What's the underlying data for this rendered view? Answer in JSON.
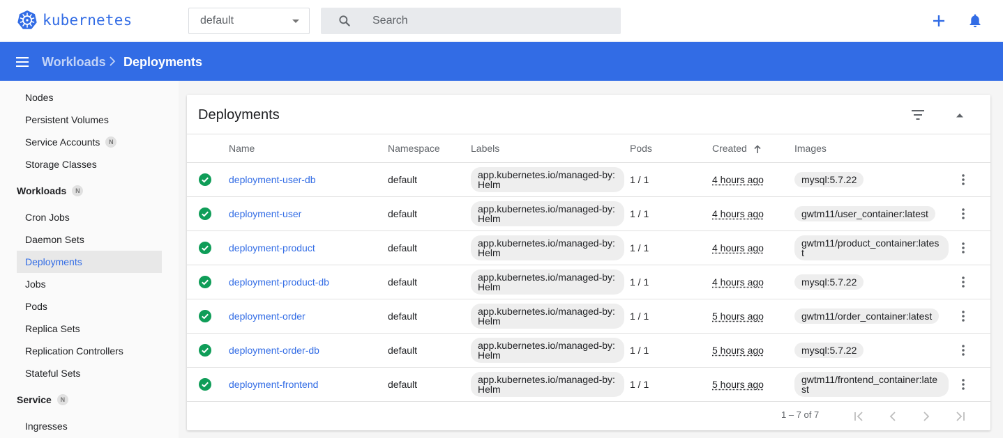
{
  "app": {
    "name": "kubernetes",
    "brand_color": "#326ce5"
  },
  "namespace_select": {
    "value": "default"
  },
  "search": {
    "placeholder": "Search"
  },
  "breadcrumb": {
    "root": "Workloads",
    "current": "Deployments"
  },
  "sidebar": {
    "items_top": [
      {
        "label": "Nodes"
      },
      {
        "label": "Persistent Volumes"
      },
      {
        "label": "Service Accounts",
        "badge": "N"
      },
      {
        "label": "Storage Classes"
      }
    ],
    "workloads": {
      "title": "Workloads",
      "badge": "N",
      "items": [
        {
          "label": "Cron Jobs"
        },
        {
          "label": "Daemon Sets"
        },
        {
          "label": "Deployments",
          "active": true
        },
        {
          "label": "Jobs"
        },
        {
          "label": "Pods"
        },
        {
          "label": "Replica Sets"
        },
        {
          "label": "Replication Controllers"
        },
        {
          "label": "Stateful Sets"
        }
      ]
    },
    "service": {
      "title": "Service",
      "badge": "N",
      "items": [
        {
          "label": "Ingresses"
        }
      ]
    }
  },
  "card": {
    "title": "Deployments",
    "columns": {
      "name": "Name",
      "namespace": "Namespace",
      "labels": "Labels",
      "pods": "Pods",
      "created": "Created",
      "images": "Images"
    },
    "rows": [
      {
        "status": "running",
        "name": "deployment-user-db",
        "namespace": "default",
        "labels": "app.kubernetes.io/managed-by: Helm",
        "pods": "1 / 1",
        "created": "4 hours ago",
        "image": "mysql:5.7.22"
      },
      {
        "status": "running",
        "name": "deployment-user",
        "namespace": "default",
        "labels": "app.kubernetes.io/managed-by: Helm",
        "pods": "1 / 1",
        "created": "4 hours ago",
        "image": "gwtm11/user_container:latest"
      },
      {
        "status": "running",
        "name": "deployment-product",
        "namespace": "default",
        "labels": "app.kubernetes.io/managed-by: Helm",
        "pods": "1 / 1",
        "created": "4 hours ago",
        "image": "gwtm11/product_container:latest"
      },
      {
        "status": "running",
        "name": "deployment-product-db",
        "namespace": "default",
        "labels": "app.kubernetes.io/managed-by: Helm",
        "pods": "1 / 1",
        "created": "4 hours ago",
        "image": "mysql:5.7.22"
      },
      {
        "status": "running",
        "name": "deployment-order",
        "namespace": "default",
        "labels": "app.kubernetes.io/managed-by: Helm",
        "pods": "1 / 1",
        "created": "5 hours ago",
        "image": "gwtm11/order_container:latest"
      },
      {
        "status": "running",
        "name": "deployment-order-db",
        "namespace": "default",
        "labels": "app.kubernetes.io/managed-by: Helm",
        "pods": "1 / 1",
        "created": "5 hours ago",
        "image": "mysql:5.7.22"
      },
      {
        "status": "running",
        "name": "deployment-frontend",
        "namespace": "default",
        "labels": "app.kubernetes.io/managed-by: Helm",
        "pods": "1 / 1",
        "created": "5 hours ago",
        "image": "gwtm11/frontend_container:latest"
      }
    ],
    "pagination": {
      "range": "1 – 7 of 7"
    }
  },
  "colors": {
    "success": "#0f9d58",
    "appbar": "#326ce5"
  }
}
